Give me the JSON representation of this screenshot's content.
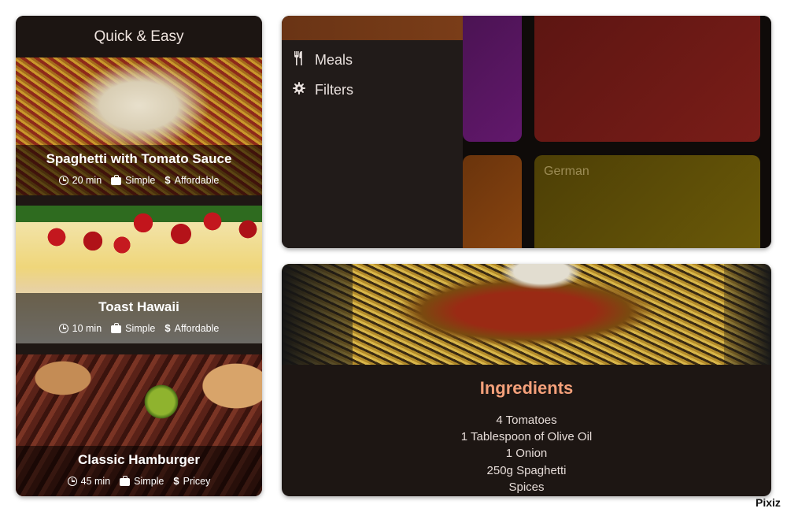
{
  "left_screen": {
    "title": "Quick & Easy",
    "meals": [
      {
        "title": "Spaghetti with Tomato Sauce",
        "duration": "20 min",
        "complexity": "Simple",
        "affordability": "Affordable"
      },
      {
        "title": "Toast Hawaii",
        "duration": "10 min",
        "complexity": "Simple",
        "affordability": "Affordable"
      },
      {
        "title": "Classic Hamburger",
        "duration": "45 min",
        "complexity": "Simple",
        "affordability": "Pricey"
      }
    ]
  },
  "drawer_screen": {
    "nav": [
      {
        "label": "Meals",
        "icon": "restaurant-icon"
      },
      {
        "label": "Filters",
        "icon": "settings-icon"
      }
    ],
    "tiles": [
      {
        "label": "",
        "color": "#62186c"
      },
      {
        "label": "",
        "color": "#7a1d18"
      },
      {
        "label": "",
        "color": "#8a4510"
      },
      {
        "label": "German",
        "color": "#6b5a08"
      }
    ],
    "accent": "#7a3d18"
  },
  "detail_screen": {
    "section_title": "Ingredients",
    "ingredients": [
      "4 Tomatoes",
      "1 Tablespoon of Olive Oil",
      "1 Onion",
      "250g Spaghetti",
      "Spices"
    ],
    "accent": "#f4a07a"
  },
  "watermark": "Pixiz"
}
